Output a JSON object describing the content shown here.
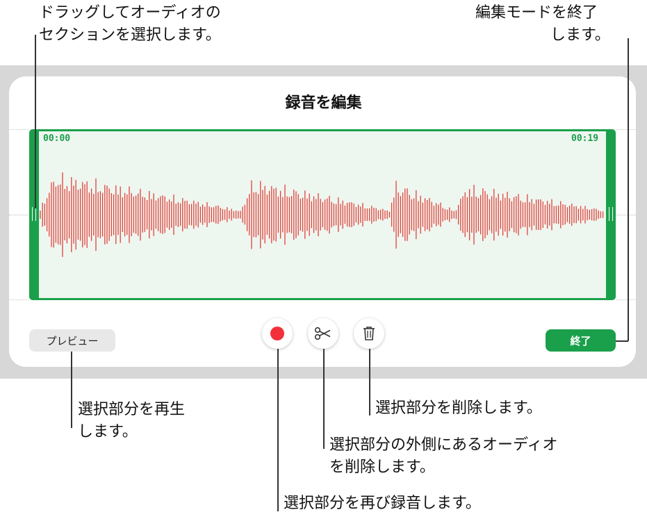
{
  "dialog": {
    "title": "録音を編集",
    "start_time": "00:00",
    "end_time": "00:19",
    "preview_label": "プレビュー",
    "done_label": "終了"
  },
  "toolbar": {
    "record_icon": "record-icon",
    "trim_icon": "scissors-icon",
    "delete_icon": "trash-icon"
  },
  "callouts": {
    "drag_line1": "ドラッグしてオーディオの",
    "drag_line2": "セクションを選択します。",
    "exit_line1": "編集モードを終了",
    "exit_line2": "します。",
    "play_line1": "選択部分を再生",
    "play_line2": "します。",
    "delete_sel": "選択部分を削除します。",
    "trim_line1": "選択部分の外側にあるオーディオ",
    "trim_line2": "を削除します。",
    "rerecord": "選択部分を再び録音します。"
  },
  "colors": {
    "accent": "#1aa04b",
    "waveform": "#e0423a",
    "record": "#f2303a"
  }
}
